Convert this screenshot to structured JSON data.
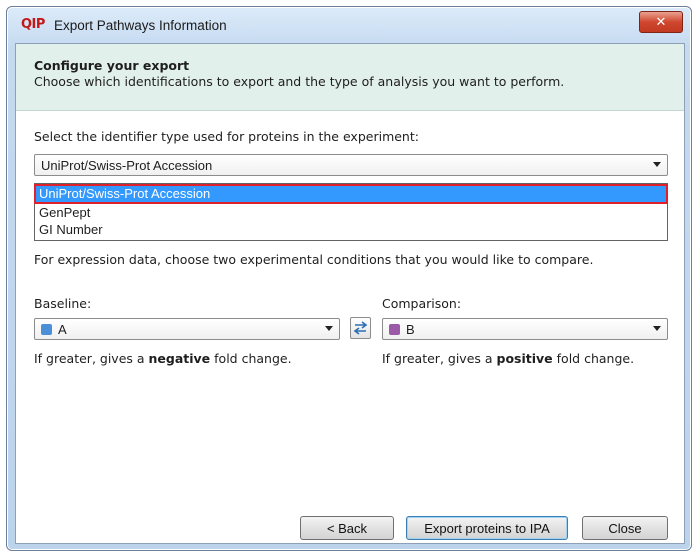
{
  "window": {
    "app_logo": "QIP",
    "title": "Export Pathways Information",
    "close_glyph": "✕"
  },
  "header": {
    "title": "Configure your export",
    "description": "Choose which identifications to export and the type of analysis you want to perform."
  },
  "identifier": {
    "label": "Select the identifier type used for proteins in the experiment:",
    "selected": "UniProt/Swiss-Prot Accession",
    "options": [
      "UniProt/Swiss-Prot Accession",
      "GenPept",
      "GI Number"
    ],
    "highlighted_index": 0
  },
  "expression": {
    "description": "For expression data, choose two experimental conditions that you would like to compare.",
    "baseline": {
      "label": "Baseline:",
      "value": "A",
      "color": "#4a8fd8",
      "note_prefix": "If greater, gives a ",
      "note_emphasis": "negative",
      "note_suffix": " fold change."
    },
    "comparison": {
      "label": "Comparison:",
      "value": "B",
      "color": "#9b5aa8",
      "note_prefix": "If greater, gives a ",
      "note_emphasis": "positive",
      "note_suffix": " fold change."
    },
    "swap_icon": "swap-arrows-icon"
  },
  "footer": {
    "back_label": "< Back",
    "export_label": "Export proteins to IPA",
    "close_label": "Close"
  },
  "colors": {
    "header_bg": "#e2f0ec",
    "selection": "#3399ff",
    "highlight_border": "#e0202a"
  }
}
